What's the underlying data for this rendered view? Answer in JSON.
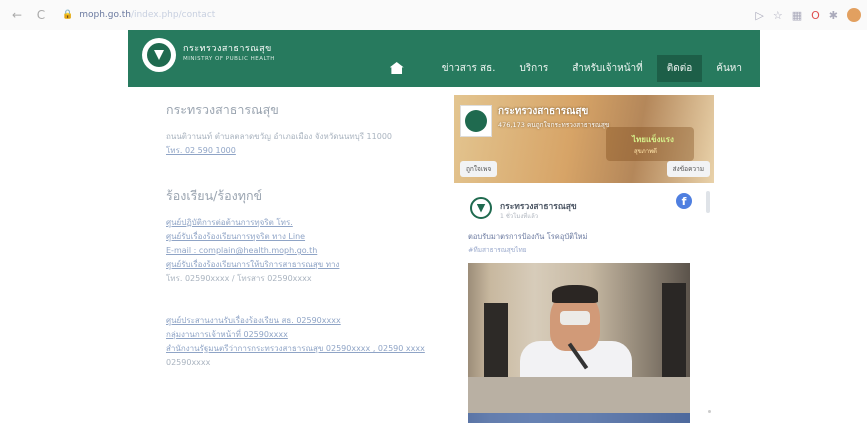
{
  "browser": {
    "url_host": "moph.go.th",
    "url_path": "/index.php/contact",
    "nav_back": "←",
    "nav_reload": "C"
  },
  "header": {
    "brand_th": "กระทรวงสาธารณสุข",
    "brand_en": "MINISTRY OF PUBLIC HEALTH",
    "menu": [
      "ข่าวสาร สธ.",
      "บริการ",
      "สำหรับเจ้าหน้าที่",
      "ติดต่อ",
      "ค้นหา"
    ],
    "active_index": 3,
    "colors": {
      "header": "#277a5e",
      "active": "#1d5f48"
    }
  },
  "contact": {
    "title": "กระทรวงสาธารณสุข",
    "address": "ถนนติวานนท์ ตำบลตลาดขวัญ อำเภอเมือง จังหวัดนนทบุรี 11000",
    "phone": "โทร. 02 590 1000",
    "complaint_title": "ร้องเรียน/ร้องทุกข์",
    "links": [
      "ศูนย์ปฏิบัติการต่อต้านการทุจริต โทร.",
      "ศูนย์รับเรื่องร้องเรียนการทุจริต ทาง Line",
      "E-mail : complain@health.moph.go.th",
      "ศูนย์รับเรื่องร้องเรียนการให้บริการสาธารณสุข ทาง"
    ],
    "hotline": "โทร. 02590xxxx / โทรสาร 02590xxxx",
    "more_links": [
      "ศูนย์ประสานงานรับเรื่องร้องเรียน สธ. 02590xxxx",
      "กลุ่มงานการเจ้าหน้าที่ 02590xxxx",
      "สำนักงานรัฐมนตรีว่าการกระทรวงสาธารณสุข 02590xxxx , 02590 xxxx",
      "02590xxxx"
    ]
  },
  "facebook": {
    "page_name": "กระทรวงสาธารณสุข",
    "likes": "476,173 คนถูกใจกระทรวงสาธารณสุข",
    "banner_text": "ไทยแข็งแรง",
    "banner_sub": "สุขภาพดี",
    "like_button": "ถูกใจเพจ",
    "message_button": "ส่งข้อความ",
    "post_author": "กระทรวงสาธารณสุข",
    "post_time": "1 ชั่วโมงที่แล้ว",
    "caption1": "ตอบรับมาตรการป้องกัน       โรคอุบัติใหม่",
    "caption2": "#ทีมสาธารณสุขไทย",
    "fb_icon": "f"
  }
}
